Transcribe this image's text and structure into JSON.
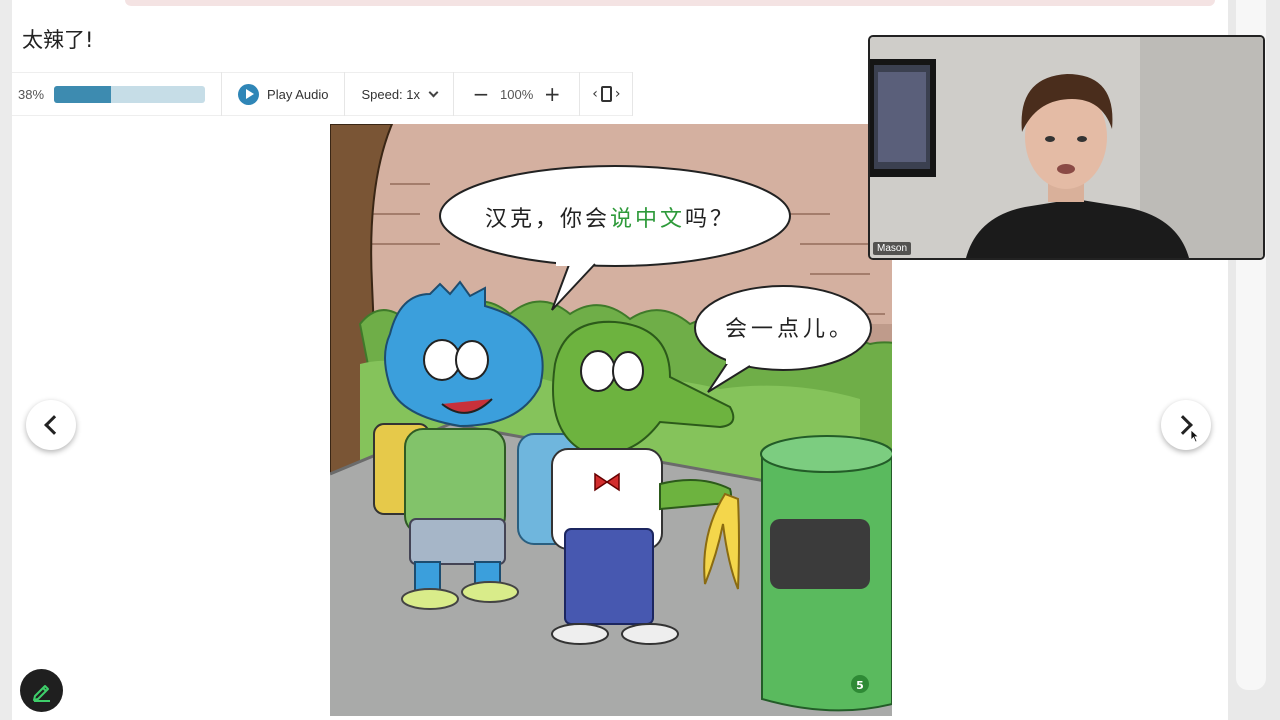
{
  "header": {
    "title": "太辣了!"
  },
  "toolbar": {
    "progress": {
      "label": "38%",
      "value": 0.38
    },
    "play_audio_label": "Play Audio",
    "speed_label": "Speed: 1x",
    "zoom_value": "100%",
    "zoom_out_symbol": "−",
    "zoom_in_symbol": "+",
    "layout_left_symbol": "‹",
    "layout_right_symbol": "›"
  },
  "comic": {
    "bubble_1": {
      "pre": "汉克，你会",
      "highlight": "说中文",
      "post": "吗？"
    },
    "bubble_2": "会一点儿。",
    "page_number": "5"
  },
  "video": {
    "participant_name": "Mason"
  },
  "icons": [
    "play-icon",
    "chevron-down-icon",
    "minus-icon",
    "plus-icon",
    "layout-toggle-icon",
    "chevron-left-icon",
    "chevron-right-icon",
    "pencil-icon",
    "mouse-cursor-icon"
  ],
  "colors": {
    "accent": "#3d8bb0",
    "progress_track": "#c6dde7",
    "highlight_text": "#2e9a3a",
    "edit_button_bg": "#1f1f1f",
    "edit_icon": "#3ecf6a"
  }
}
